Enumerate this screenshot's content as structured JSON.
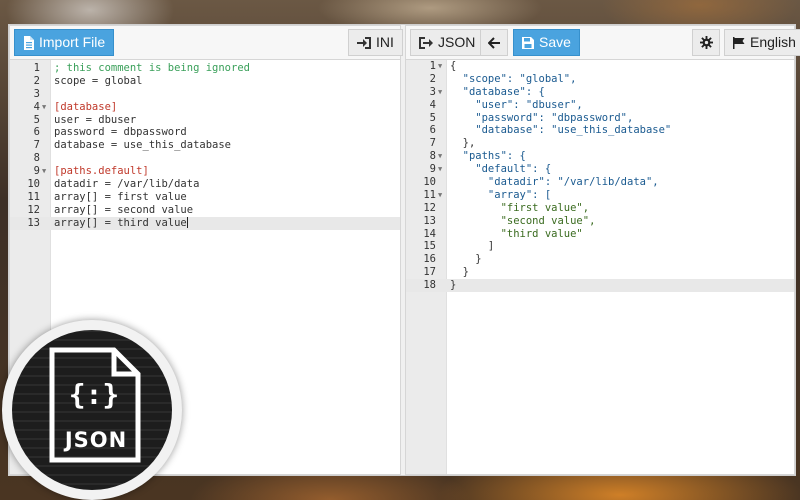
{
  "left_toolbar": {
    "import_label": "Import File",
    "format_label": "INI"
  },
  "right_toolbar": {
    "format_label": "JSON",
    "save_label": "Save",
    "language_label": "English"
  },
  "ini_editor": {
    "lines": [
      {
        "num": "1",
        "text": "; this comment is being ignored"
      },
      {
        "num": "2",
        "text": "scope = global"
      },
      {
        "num": "3",
        "text": ""
      },
      {
        "num": "4",
        "text": "[database]"
      },
      {
        "num": "5",
        "text": "user = dbuser"
      },
      {
        "num": "6",
        "text": "password = dbpassword"
      },
      {
        "num": "7",
        "text": "database = use_this_database"
      },
      {
        "num": "8",
        "text": ""
      },
      {
        "num": "9",
        "text": "[paths.default]"
      },
      {
        "num": "10",
        "text": "datadir = /var/lib/data"
      },
      {
        "num": "11",
        "text": "array[] = first value"
      },
      {
        "num": "12",
        "text": "array[] = second value"
      },
      {
        "num": "13",
        "text": "array[] = third value"
      }
    ]
  },
  "json_editor": {
    "lines": [
      {
        "num": "1",
        "text": "{"
      },
      {
        "num": "2",
        "text": "  \"scope\": \"global\","
      },
      {
        "num": "3",
        "text": "  \"database\": {"
      },
      {
        "num": "4",
        "text": "    \"user\": \"dbuser\","
      },
      {
        "num": "5",
        "text": "    \"password\": \"dbpassword\","
      },
      {
        "num": "6",
        "text": "    \"database\": \"use_this_database\""
      },
      {
        "num": "7",
        "text": "  },"
      },
      {
        "num": "8",
        "text": "  \"paths\": {"
      },
      {
        "num": "9",
        "text": "    \"default\": {"
      },
      {
        "num": "10",
        "text": "      \"datadir\": \"/var/lib/data\","
      },
      {
        "num": "11",
        "text": "      \"array\": ["
      },
      {
        "num": "12",
        "text": "        \"first value\","
      },
      {
        "num": "13",
        "text": "        \"second value\","
      },
      {
        "num": "14",
        "text": "        \"third value\""
      },
      {
        "num": "15",
        "text": "      ]"
      },
      {
        "num": "16",
        "text": "    }"
      },
      {
        "num": "17",
        "text": "  }"
      },
      {
        "num": "18",
        "text": "}"
      }
    ]
  },
  "logo": {
    "braces": "{:}",
    "label": "JSON"
  },
  "colors": {
    "primary_button": "#4aa3df",
    "comment": "#3aa05a",
    "section": "#c0392b"
  },
  "icons": {
    "import": "file-icon",
    "ini_format": "sign-in-icon",
    "json_format": "sign-out-icon",
    "back": "arrow-left-icon",
    "save": "floppy-disk-icon",
    "settings": "gear-icon",
    "language": "flag-icon"
  }
}
